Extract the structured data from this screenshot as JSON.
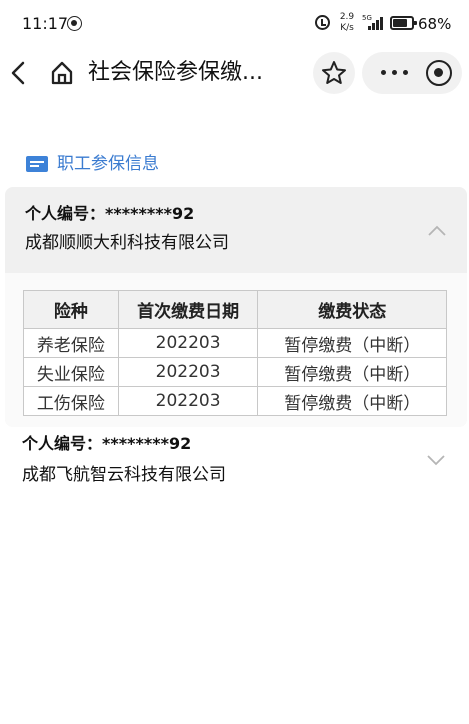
{
  "status_bar": {
    "time": "11:17",
    "speed_value": "2.9",
    "speed_unit": "K/s",
    "network": "5G",
    "battery": "68%"
  },
  "nav": {
    "title": "社会保险参保缴...",
    "icons": [
      "back-arrow-icon",
      "home-icon",
      "star-icon",
      "more-icon",
      "target-icon"
    ]
  },
  "section": {
    "title": "职工参保信息",
    "icon": "id-card-icon",
    "accent_color": "#3a7bd0"
  },
  "companies": [
    {
      "person_id_label": "个人编号：",
      "person_id": "********92",
      "name": "成都顺顺大利科技有限公司",
      "expanded": true,
      "table": {
        "headers": [
          "险种",
          "首次缴费日期",
          "缴费状态"
        ],
        "rows": [
          [
            "养老保险",
            "202203",
            "暂停缴费（中断）"
          ],
          [
            "失业保险",
            "202203",
            "暂停缴费（中断）"
          ],
          [
            "工伤保险",
            "202203",
            "暂停缴费（中断）"
          ]
        ]
      }
    },
    {
      "person_id_label": "个人编号：",
      "person_id": "********92",
      "name": "成都飞航智云科技有限公司",
      "expanded": false
    }
  ]
}
